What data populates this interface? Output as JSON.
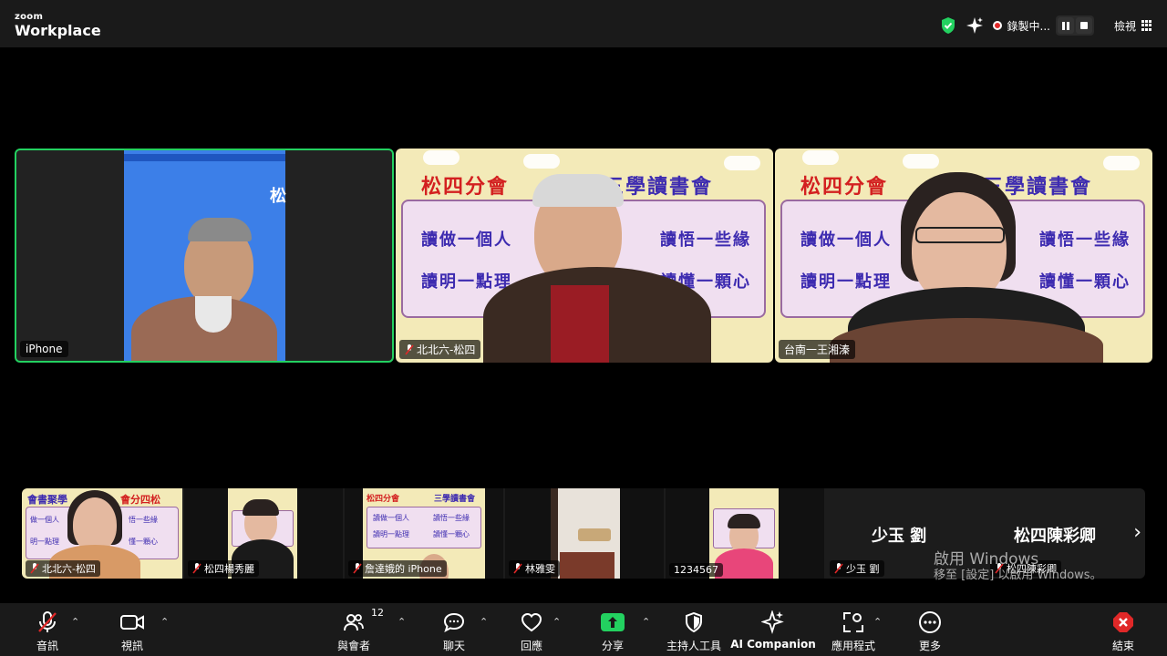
{
  "app": {
    "logo_top": "zoom",
    "logo_bottom": "Workplace"
  },
  "topbar": {
    "recording_label": "錄製中...",
    "view_label": "檢視"
  },
  "colors": {
    "active_speaker_border": "#23d160",
    "share_green": "#23d160",
    "rec_red": "#e02828",
    "poster_red": "#d32020",
    "poster_blue": "#3d2bb0"
  },
  "poster": {
    "title_left": "松四分會",
    "title_right": "三學讀書會",
    "line1": "讀做一個人",
    "line2": "讀悟一些緣",
    "line3": "讀明一點理",
    "line4": "讀懂一顆心",
    "sign_fragment": "松"
  },
  "main_tiles": [
    {
      "name": "iPhone",
      "muted": false
    },
    {
      "name": "北北六-松四",
      "muted": true
    },
    {
      "name": "台南一王湘溱",
      "muted": true
    }
  ],
  "thumb_poster": {
    "title_left": "會書聚學",
    "title_right": "會分四松",
    "line1": "做一個人",
    "line2": "明一點理",
    "line3": "悟一些緣",
    "line4": "懂一顆心"
  },
  "thumbnails": [
    {
      "name": "北北六-松四",
      "muted": true
    },
    {
      "name": "松四楊秀麗",
      "muted": true
    },
    {
      "name": "詹達娥的 iPhone",
      "muted": true
    },
    {
      "name": "林雅雯",
      "muted": true
    },
    {
      "name": "1234567",
      "muted": false
    },
    {
      "name": "少玉 劉",
      "muted": true,
      "display_name": "少玉 劉"
    },
    {
      "name": "松四陳彩卿",
      "muted": true,
      "display_name": "松四陳彩卿"
    }
  ],
  "windows_watermark": {
    "line1": "啟用 Windows",
    "line2": "移至 [設定] 以啟用 Windows。"
  },
  "toolbar": {
    "audio": "音訊",
    "video": "視訊",
    "participants": "與會者",
    "participants_count": "12",
    "chat": "聊天",
    "reactions": "回應",
    "share": "分享",
    "host_tools": "主持人工具",
    "ai_companion": "AI Companion",
    "apps": "應用程式",
    "more": "更多",
    "end": "結束"
  }
}
